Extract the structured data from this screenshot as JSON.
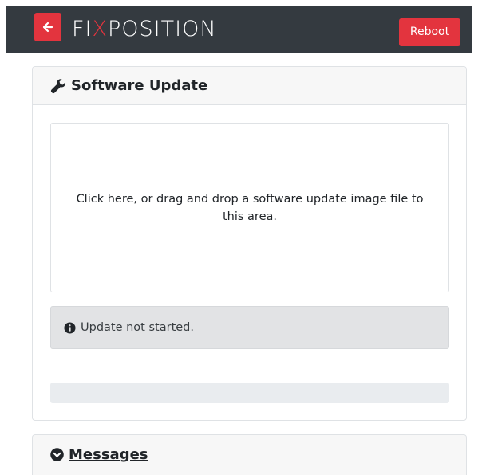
{
  "navbar": {
    "back_icon": "arrow-left-icon",
    "brand_prefix": "FI",
    "brand_x": "X",
    "brand_suffix": "POSITION",
    "reboot_label": "Reboot",
    "accent_color": "#e3343e",
    "background_color": "#343a40"
  },
  "update_card": {
    "icon": "wrench-icon",
    "title": "Software Update",
    "dropzone_text": "Click here, or drag and drop a software update image file to this area.",
    "status_icon": "info-circle-icon",
    "status_text": "Update not started.",
    "progress_fraction": 0
  },
  "messages_card": {
    "icon": "chevron-circle-down-icon",
    "title": " Messages"
  }
}
